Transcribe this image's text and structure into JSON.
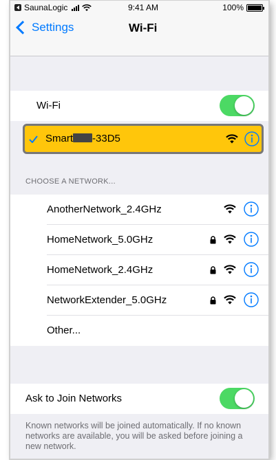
{
  "status_bar": {
    "carrier": "SaunaLogic",
    "time": "9:41 AM",
    "battery": "100%"
  },
  "nav": {
    "back_label": "Settings",
    "title": "Wi-Fi"
  },
  "wifi_toggle": {
    "label": "Wi-Fi",
    "on": true
  },
  "connected": {
    "name_prefix": "Smart",
    "name_suffix": "-33D5",
    "highlight_color": "#ffc60b"
  },
  "section_header": "CHOOSE A NETWORK...",
  "networks": [
    {
      "name": "AnotherNetwork_2.4GHz",
      "locked": false
    },
    {
      "name": "HomeNetwork_5.0GHz",
      "locked": true
    },
    {
      "name": "HomeNetwork_2.4GHz",
      "locked": true
    },
    {
      "name": "NetworkExtender_5.0GHz",
      "locked": true
    }
  ],
  "other_label": "Other...",
  "ask_to_join": {
    "label": "Ask to Join Networks",
    "on": true
  },
  "footer_text": "Known networks will be joined automatically. If no known networks are available, you will be asked before joining a new network.",
  "colors": {
    "accent": "#007aff",
    "toggle_on": "#4cd964"
  },
  "icons": [
    "wifi-icon",
    "info-icon",
    "lock-icon",
    "checkmark-icon",
    "chevron-left-icon"
  ]
}
